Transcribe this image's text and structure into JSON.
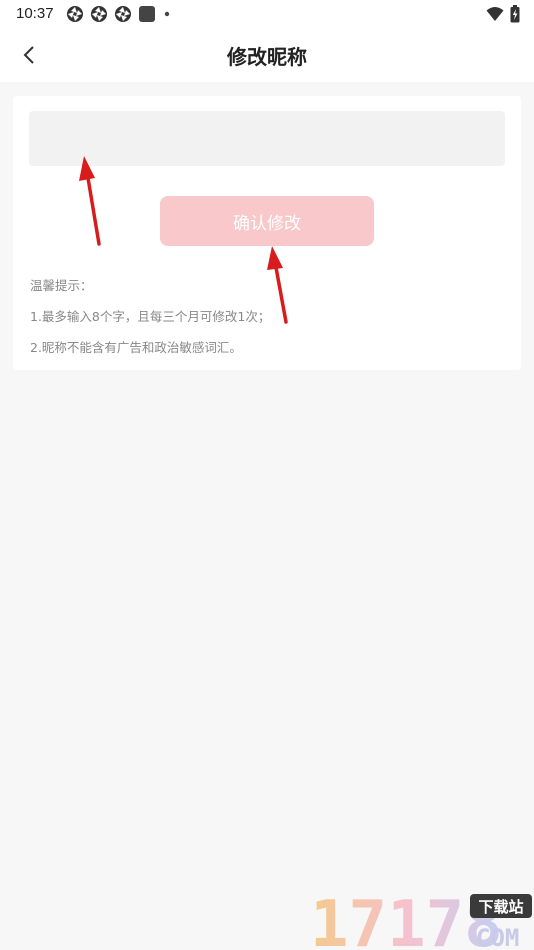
{
  "status_bar": {
    "time": "10:37",
    "left_icons": [
      "app-notification-icon",
      "app-notification-icon",
      "app-notification-icon",
      "square-app-icon",
      "dot-icon"
    ],
    "right_icons": [
      "wifi-icon",
      "battery-charging-icon"
    ]
  },
  "header": {
    "title": "修改昵称",
    "back_icon": "chevron-left-icon"
  },
  "form": {
    "nickname_value": "",
    "nickname_placeholder": "",
    "confirm_label": "确认修改"
  },
  "tips": {
    "heading": "温馨提示：",
    "line1": "1.最多输入8个字，且每三个月可修改1次；",
    "line2": "2.昵称不能含有广告和政治敏感词汇。"
  },
  "watermark": {
    "number": "17178",
    "badge": "下载站",
    "domain": "COM"
  },
  "colors": {
    "page_bg": "#f7f7f7",
    "button_bg": "#f8c8cb",
    "input_bg": "#f2f2f2",
    "annotation_arrow": "#d81c1c"
  }
}
